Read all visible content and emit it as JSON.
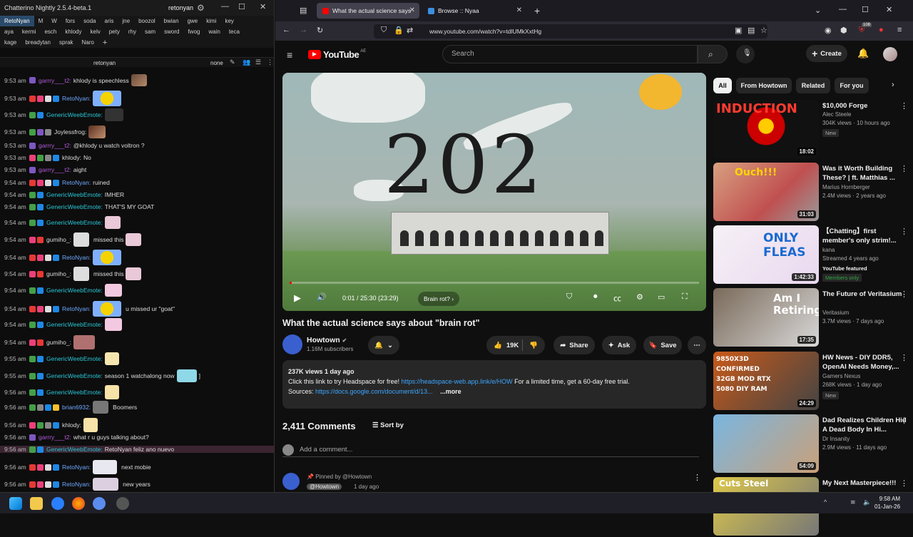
{
  "chatterino": {
    "title": "Chatterino Nightly 2.5.4-beta.1",
    "account": "retonyan",
    "channels_row1": [
      "RetoNyan",
      "M",
      "W",
      "fors",
      "soda",
      "aris",
      "jne",
      "boozol",
      "bwian",
      "gwe",
      "kimi",
      "key"
    ],
    "channels_row2": [
      "aya",
      "kermi",
      "esch",
      "khlody",
      "kelv",
      "pety",
      "rhy",
      "sam",
      "sword",
      "fwog",
      "wain",
      "teca"
    ],
    "channels_row3": [
      "kage",
      "breadytan",
      "sprak",
      "Naro"
    ],
    "add_tab": "+",
    "channel_name": "retonyan",
    "mode": "none",
    "messages": [
      {
        "time": "9:53 am",
        "user": "garrry___t2:",
        "text": "khlody is speechless"
      },
      {
        "time": "9:53 am",
        "user": "RetoNyan:",
        "text": ""
      },
      {
        "time": "9:53 am",
        "user": "GenericWeebEmote:",
        "text": ""
      },
      {
        "time": "9:53 am",
        "user": "Joylessfrog:",
        "text": ""
      },
      {
        "time": "9:53 am",
        "user": "garrry___t2:",
        "text": "@khlody u watch voltron ?"
      },
      {
        "time": "9:53 am",
        "user": "khlody:",
        "text": "No"
      },
      {
        "time": "9:53 am",
        "user": "garrry___t2:",
        "text": "aight"
      },
      {
        "time": "9:54 am",
        "user": "RetoNyan:",
        "text": "ruined"
      },
      {
        "time": "9:54 am",
        "user": "GenericWeebEmote:",
        "text": "IMHER"
      },
      {
        "time": "9:54 am",
        "user": "GenericWeebEmote:",
        "text": "THAT'S MY GOAT"
      },
      {
        "time": "9:54 am",
        "user": "GenericWeebEmote:",
        "text": ""
      },
      {
        "time": "9:54 am",
        "user": "gumiho_:",
        "text": "missed this"
      },
      {
        "time": "9:54 am",
        "user": "RetoNyan:",
        "text": ""
      },
      {
        "time": "9:54 am",
        "user": "gumiho_:",
        "text": "missed this"
      },
      {
        "time": "9:54 am",
        "user": "GenericWeebEmote:",
        "text": ""
      },
      {
        "time": "9:54 am",
        "user": "RetoNyan:",
        "text": "u missed ur \"goat\""
      },
      {
        "time": "9:54 am",
        "user": "GenericWeebEmote:",
        "text": ""
      },
      {
        "time": "9:54 am",
        "user": "gumiho_:",
        "text": ""
      },
      {
        "time": "9:55 am",
        "user": "GenericWeebEmote:",
        "text": ""
      },
      {
        "time": "9:55 am",
        "user": "GenericWeebEmote:",
        "text": "season 1 watchalong now"
      },
      {
        "time": "9:56 am",
        "user": "GenericWeebEmote:",
        "text": ""
      },
      {
        "time": "9:56 am",
        "user": "brian6932:",
        "text": "Boomers"
      },
      {
        "time": "9:56 am",
        "user": "khlody:",
        "text": ""
      },
      {
        "time": "9:56 am",
        "user": "garrry___t2:",
        "text": "what r u guys talking about?"
      },
      {
        "time": "9:56 am",
        "user": "GenericWeebEmote:",
        "text": "RetoNyan feliz ano nuevo"
      },
      {
        "time": "9:56 am",
        "user": "RetoNyan:",
        "text": "next mobie"
      },
      {
        "time": "9:56 am",
        "user": "RetoNyan:",
        "text": "new years"
      }
    ],
    "msg_extra": {
      "m19_tail": "]"
    }
  },
  "browser": {
    "tabs": [
      {
        "title": "What the actual science says ab",
        "active": true
      },
      {
        "title": "Browse :: Nyaa",
        "active": false
      }
    ],
    "new_tab": "+",
    "url": "www.youtube.com/watch?v=tdlUMkXxtHg",
    "badge_count": "108"
  },
  "youtube": {
    "logo": "YouTube",
    "logo_region": "AE",
    "search_placeholder": "Search",
    "create_label": "Create",
    "player": {
      "scene_text": "202",
      "time": "0:01 / 25:30 (23:29)",
      "chapter": "Brain rot?",
      "progress_fraction": 0.0007
    },
    "title": "What the actual science says about \"brain rot\"",
    "channel": "Howtown",
    "subscribers": "1.16M subscribers",
    "likes": "19K",
    "share": "Share",
    "ask": "Ask",
    "save": "Save",
    "description": {
      "meta": "237K views  1 day ago",
      "line1_pre": "Click this link to try Headspace for free! ",
      "line1_link": "https://headspace-web.app.link/e/HOW",
      "line1_post": " For a limited time, get a 60-day free trial.",
      "sources_label": "Sources: ",
      "sources_link": "https://docs.google.com/document/d/13...",
      "more": "...more"
    },
    "comments_count": "2,411 Comments",
    "sort_by": "Sort by",
    "add_comment": "Add a comment...",
    "pinned": "Pinned by @Howtown",
    "pinned_author": "@Howtown",
    "pinned_time": "1 day ago",
    "chips": [
      "All",
      "From Howtown",
      "Related",
      "For you"
    ],
    "recommended": [
      {
        "title": "$10,000 Forge",
        "channel": "Alec Steele",
        "meta": "304K views · 10 hours ago",
        "badge": "New",
        "duration": "18:02",
        "thumb_text": "INDUCTION"
      },
      {
        "title": "Was it Worth Building These? | ft. Matthias ...",
        "channel": "Marius Hornberger",
        "meta": "2.4M views · 2 years ago",
        "badge": "",
        "duration": "31:03",
        "thumb_text": "Ouch!!!"
      },
      {
        "title": "【Chatting】first member's only strim!...",
        "channel": "kana",
        "meta": "Streamed 4 years ago",
        "badge": "YouTube featured",
        "badge2": "Members only",
        "duration": "1:42:33",
        "thumb_text": "ONLY FLEAS"
      },
      {
        "title": "The Future of Veritasium",
        "channel": "Veritasium",
        "meta": "3.7M views · 7 days ago",
        "badge": "",
        "duration": "17:35",
        "thumb_text": "Am I Retiring?"
      },
      {
        "title": "HW News - DIY DDR5, OpenAI Needs Money,...",
        "channel": "Gamers Nexus",
        "meta": "268K views · 1 day ago",
        "badge": "New",
        "duration": "24:29",
        "thumb_text": "9850X3D CONFIRMED 32GB MOD RTX 5080 DIY RAM"
      },
      {
        "title": "Dad Realizes Children Hid A Dead Body In Hi...",
        "channel": "Dr Insanity",
        "meta": "2.9M views · 11 days ago",
        "badge": "",
        "duration": "54:09",
        "thumb_text": ""
      },
      {
        "title": "My Next Masterpiece!!!",
        "channel": "",
        "meta": "",
        "badge": "",
        "duration": "",
        "thumb_text": "Cuts Steel"
      }
    ]
  },
  "taskbar": {
    "time": "9:58 AM",
    "date": "01-Jan-26"
  },
  "colors": {
    "yt_red": "#ff0000",
    "link": "#3ea6ff",
    "chat_bg": "#0d0d0d"
  }
}
